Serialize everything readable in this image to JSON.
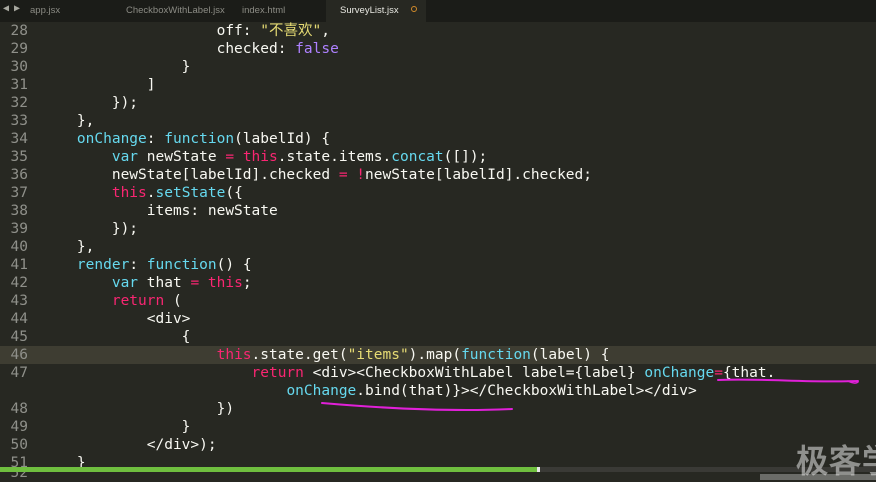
{
  "tabs": [
    {
      "label": "app.jsx",
      "active": false
    },
    {
      "label": "CheckboxWithLabel.jsx",
      "active": false
    },
    {
      "label": "index.html",
      "active": false
    },
    {
      "label": "SurveyList.jsx",
      "active": true,
      "unsaved": true
    }
  ],
  "nav": {
    "back_icon": "◀",
    "forward_icon": "▶"
  },
  "editor": {
    "highlighted_line": 46,
    "lines": [
      {
        "num": "28",
        "tokens": [
          [
            "pl",
            "                    off: "
          ],
          [
            "st",
            "\"不喜欢\""
          ],
          [
            "pl",
            ","
          ]
        ]
      },
      {
        "num": "29",
        "tokens": [
          [
            "pl",
            "                    checked: "
          ],
          [
            "num",
            "false"
          ]
        ]
      },
      {
        "num": "30",
        "tokens": [
          [
            "pl",
            "                }"
          ]
        ]
      },
      {
        "num": "31",
        "tokens": [
          [
            "pl",
            "            ]"
          ]
        ]
      },
      {
        "num": "32",
        "tokens": [
          [
            "pl",
            "        });"
          ]
        ]
      },
      {
        "num": "33",
        "tokens": [
          [
            "pl",
            "    },"
          ]
        ]
      },
      {
        "num": "34",
        "tokens": [
          [
            "pl",
            "    "
          ],
          [
            "fn",
            "onChange"
          ],
          [
            "pl",
            ": "
          ],
          [
            "fn",
            "function"
          ],
          [
            "pl",
            "(labelId) {"
          ]
        ]
      },
      {
        "num": "35",
        "tokens": [
          [
            "pl",
            "        "
          ],
          [
            "fn",
            "var"
          ],
          [
            "pl",
            " newState "
          ],
          [
            "kw",
            "="
          ],
          [
            "pl",
            " "
          ],
          [
            "kw",
            "this"
          ],
          [
            "pl",
            ".state.items."
          ],
          [
            "fn",
            "concat"
          ],
          [
            "pl",
            "([]);"
          ]
        ]
      },
      {
        "num": "36",
        "tokens": [
          [
            "pl",
            "        newState[labelId].checked "
          ],
          [
            "kw",
            "="
          ],
          [
            "pl",
            " "
          ],
          [
            "kw",
            "!"
          ],
          [
            "pl",
            "newState[labelId].checked;"
          ]
        ]
      },
      {
        "num": "37",
        "tokens": [
          [
            "pl",
            "        "
          ],
          [
            "kw",
            "this"
          ],
          [
            "pl",
            "."
          ],
          [
            "fn",
            "setState"
          ],
          [
            "pl",
            "({"
          ]
        ]
      },
      {
        "num": "38",
        "tokens": [
          [
            "pl",
            "            items: newState"
          ]
        ]
      },
      {
        "num": "39",
        "tokens": [
          [
            "pl",
            "        });"
          ]
        ]
      },
      {
        "num": "40",
        "tokens": [
          [
            "pl",
            "    },"
          ]
        ]
      },
      {
        "num": "41",
        "tokens": [
          [
            "pl",
            "    "
          ],
          [
            "fn",
            "render"
          ],
          [
            "pl",
            ": "
          ],
          [
            "fn",
            "function"
          ],
          [
            "pl",
            "() {"
          ]
        ]
      },
      {
        "num": "42",
        "tokens": [
          [
            "pl",
            "        "
          ],
          [
            "fn",
            "var"
          ],
          [
            "pl",
            " that "
          ],
          [
            "kw",
            "="
          ],
          [
            "pl",
            " "
          ],
          [
            "kw",
            "this"
          ],
          [
            "pl",
            ";"
          ]
        ]
      },
      {
        "num": "43",
        "tokens": [
          [
            "pl",
            "        "
          ],
          [
            "kw",
            "return"
          ],
          [
            "pl",
            " ("
          ]
        ]
      },
      {
        "num": "44",
        "tokens": [
          [
            "pl",
            "            <div>"
          ]
        ]
      },
      {
        "num": "45",
        "tokens": [
          [
            "pl",
            "                {"
          ]
        ]
      },
      {
        "num": "46",
        "tokens": [
          [
            "pl",
            "                    "
          ],
          [
            "kw",
            "this"
          ],
          [
            "pl",
            ".state.get("
          ],
          [
            "st",
            "\"items\""
          ],
          [
            "pl",
            ").map("
          ],
          [
            "fn",
            "function"
          ],
          [
            "pl",
            "(label) {"
          ]
        ]
      },
      {
        "num": "47",
        "tokens": [
          [
            "pl",
            "                        "
          ],
          [
            "kw",
            "return"
          ],
          [
            "pl",
            " <div><CheckboxWithLabel label={label} "
          ],
          [
            "fn",
            "onChange"
          ],
          [
            "kw",
            "="
          ],
          [
            "pl",
            "{that."
          ]
        ]
      },
      {
        "num": "",
        "tokens": [
          [
            "pl",
            "                            "
          ],
          [
            "fn",
            "onChange"
          ],
          [
            "pl",
            ".bind(that)}></CheckboxWithLabel></div>"
          ]
        ]
      },
      {
        "num": "48",
        "tokens": [
          [
            "pl",
            "                    })"
          ]
        ]
      },
      {
        "num": "49",
        "tokens": [
          [
            "pl",
            "                }"
          ]
        ]
      },
      {
        "num": "50",
        "tokens": [
          [
            "pl",
            "            </div>);"
          ]
        ]
      },
      {
        "num": "51",
        "tokens": [
          [
            "pl",
            "    }"
          ]
        ]
      }
    ],
    "last_partial": "52"
  },
  "watermark": "极客学",
  "colors": {
    "background": "#272822",
    "annotation": "#e020d8",
    "scroll_thumb": "#6fbf3f"
  },
  "scroll": {
    "visible_fraction": 0.613
  }
}
